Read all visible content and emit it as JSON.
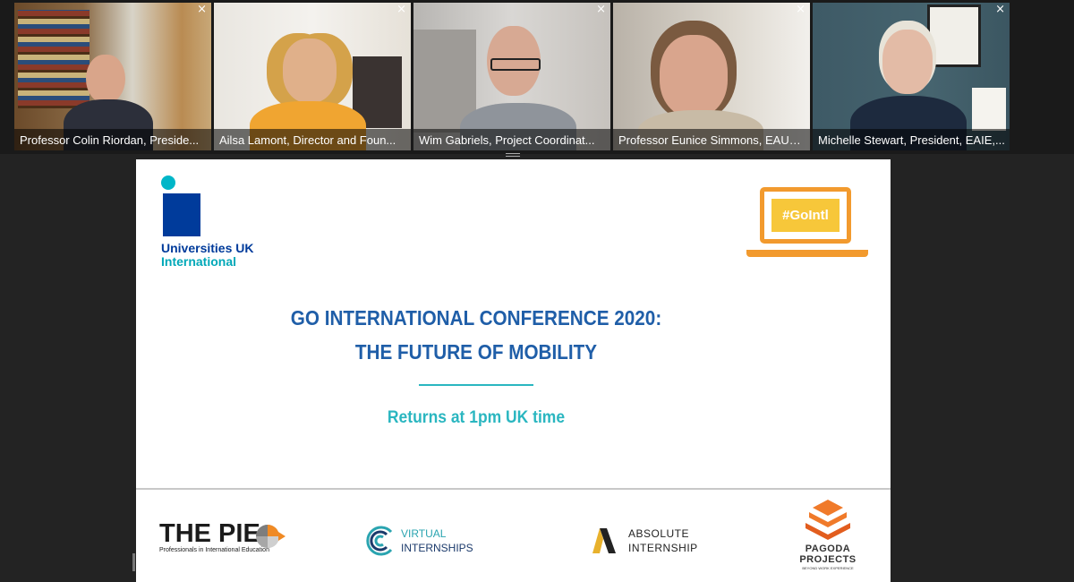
{
  "participants": [
    {
      "name": "Professor Colin Riordan, Preside...",
      "active": true,
      "close": "×"
    },
    {
      "name": "Ailsa Lamont, Director and Foun...",
      "active": false,
      "close": "×"
    },
    {
      "name": "Wim Gabriels, Project Coordinat...",
      "active": false,
      "close": "×"
    },
    {
      "name": "Professor Eunice Simmons, EAUC...",
      "active": false,
      "close": "×"
    },
    {
      "name": "Michelle Stewart, President, EAIE,...",
      "active": false,
      "close": "×"
    }
  ],
  "slide": {
    "logo_line1": "Universities UK",
    "logo_line2": "International",
    "hashtag": "#GoIntl",
    "title_line1": "GO INTERNATIONAL CONFERENCE 2020:",
    "title_line2": "THE FUTURE OF MOBILITY",
    "subtitle": "Returns at 1pm UK time",
    "sponsors": {
      "pie_name": "THE PIE",
      "pie_tagline": "Professionals in International Education",
      "vi_line1": "VIRTUAL",
      "vi_line2": "INTERNSHIPS",
      "ai_line1": "ABSOLUTE",
      "ai_line2": "INTERNSHIP",
      "pg_line1": "PAGODA",
      "pg_line2": "PROJECTS",
      "pg_tagline": "BEYOND WORK EXPERIENCE"
    }
  },
  "colors": {
    "active_speaker": "#23d18b",
    "uuk_blue": "#003b9b",
    "uuk_teal": "#00b6c8",
    "title_blue": "#1f5ea8",
    "subtitle_teal": "#2ab6c0",
    "laptop_orange": "#f29a2e"
  },
  "icons": [
    "close-icon",
    "laptop-icon",
    "pie-logo-icon",
    "virtual-internships-logo-icon",
    "absolute-internship-logo-icon",
    "pagoda-logo-icon"
  ]
}
